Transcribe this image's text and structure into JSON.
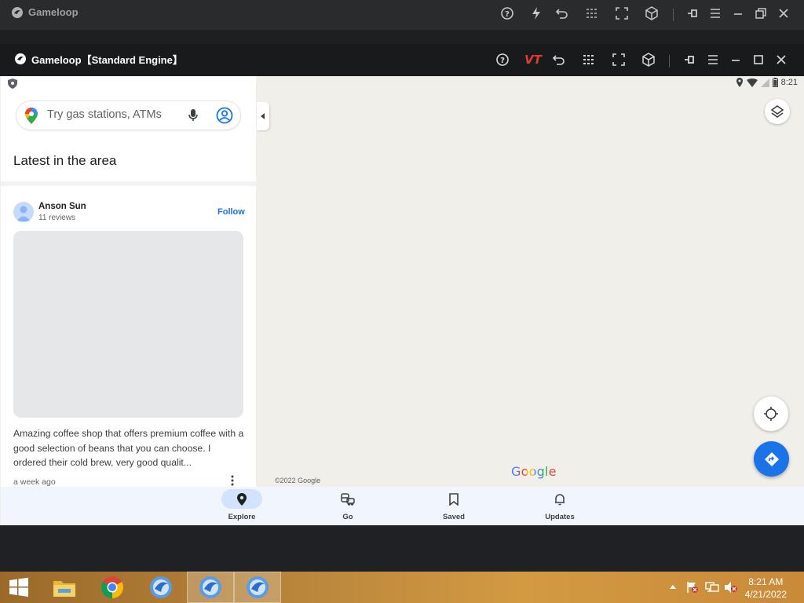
{
  "outer_window": {
    "title": "Gameloop",
    "toolbar_icons": [
      "help-icon",
      "boost-icon",
      "undo-icon",
      "grid-icon",
      "fullscreen-icon",
      "cube-icon",
      "pin-icon",
      "menu-icon",
      "minimize-icon",
      "restore-icon",
      "close-icon"
    ]
  },
  "inner_window": {
    "title": "Gameloop【Standard Engine】",
    "vt_label": "VT",
    "toolbar_icons": [
      "help-icon",
      "vt-label",
      "undo-icon",
      "grid-icon",
      "fullscreen-icon",
      "cube-icon",
      "pin-icon",
      "menu-icon",
      "minimize-icon",
      "maximize-icon",
      "close-icon"
    ]
  },
  "status_bar": {
    "time": "8:21"
  },
  "side_panel": {
    "search_placeholder": "Try gas stations, ATMs",
    "section_title": "Latest in the area",
    "post": {
      "author": "Anson Sun",
      "reviews": "11 reviews",
      "follow_label": "Follow",
      "text": "Amazing coffee shop that offers premium coffee with a good selection of beans that you can choose. I ordered their cold brew, very good qualit...",
      "age": "a week ago"
    }
  },
  "map": {
    "logo": "Google",
    "copyright": "©2022 Google",
    "background": "#f1efe9"
  },
  "bottom_nav": {
    "items": [
      {
        "label": "Explore",
        "icon": "pin-filled-icon",
        "active": true
      },
      {
        "label": "Go",
        "icon": "commute-icon",
        "active": false
      },
      {
        "label": "Saved",
        "icon": "bookmark-icon",
        "active": false
      },
      {
        "label": "Updates",
        "icon": "bell-icon",
        "active": false
      }
    ]
  },
  "taskbar": {
    "apps": [
      "windows-start-icon",
      "file-explorer-icon",
      "chrome-icon",
      "gameloop-icon",
      "gameloop-icon",
      "gameloop-icon"
    ],
    "time": "8:21 AM",
    "date": "4/21/2022"
  },
  "colors": {
    "accent": "#1a73e8",
    "vt": "#e53935",
    "nav_bg": "#f1f6fe"
  }
}
